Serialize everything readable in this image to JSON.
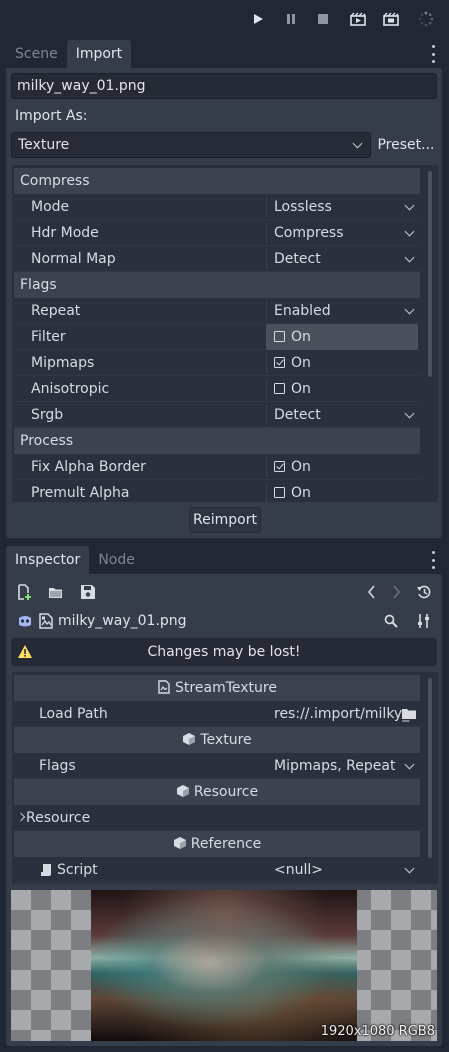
{
  "toolbar": {
    "icons": [
      "play-icon",
      "pause-icon",
      "stop-icon",
      "play-scene-icon",
      "play-custom-scene-icon",
      "loading-spinner-icon"
    ]
  },
  "import_dock": {
    "tabs": [
      "Scene",
      "Import"
    ],
    "active_tab": "Import",
    "file_name": "milky_way_01.png",
    "import_as_label": "Import As:",
    "import_as_value": "Texture",
    "preset_button": "Preset...",
    "sections": {
      "compress": "Compress",
      "flags": "Flags",
      "process": "Process"
    },
    "rows": [
      {
        "label": "Mode",
        "value": "Lossless",
        "kind": "dropdown"
      },
      {
        "label": "Hdr Mode",
        "value": "Compress",
        "kind": "dropdown"
      },
      {
        "label": "Normal Map",
        "value": "Detect",
        "kind": "dropdown"
      },
      {
        "label": "Repeat",
        "value": "Enabled",
        "kind": "dropdown"
      },
      {
        "label": "Filter",
        "value": "On",
        "kind": "checkbox",
        "checked": false,
        "hover": true
      },
      {
        "label": "Mipmaps",
        "value": "On",
        "kind": "checkbox",
        "checked": true
      },
      {
        "label": "Anisotropic",
        "value": "On",
        "kind": "checkbox",
        "checked": false
      },
      {
        "label": "Srgb",
        "value": "Detect",
        "kind": "dropdown"
      },
      {
        "label": "Fix Alpha Border",
        "value": "On",
        "kind": "checkbox",
        "checked": true
      },
      {
        "label": "Premult Alpha",
        "value": "On",
        "kind": "checkbox",
        "checked": false
      }
    ],
    "reimport_button": "Reimport"
  },
  "inspector": {
    "tabs": [
      "Inspector",
      "Node"
    ],
    "active_tab": "Inspector",
    "resource_name": "milky_way_01.png",
    "warning": "Changes may be lost!",
    "sections": {
      "stream_texture": "StreamTexture",
      "texture": "Texture",
      "resource": "Resource",
      "reference": "Reference"
    },
    "load_path_label": "Load Path",
    "load_path_value": "res://.import/milky_",
    "flags_label": "Flags",
    "flags_value": "Mipmaps, Repeat",
    "resource_group": "Resource",
    "script_label": "Script",
    "script_value": "<null>",
    "preview_info": "1920x1080 RGB8"
  },
  "colors": {
    "background": "#222736",
    "panel": "#363d4a",
    "field": "#252a36",
    "section": "#3c4250",
    "warning": "#ffdd65"
  }
}
